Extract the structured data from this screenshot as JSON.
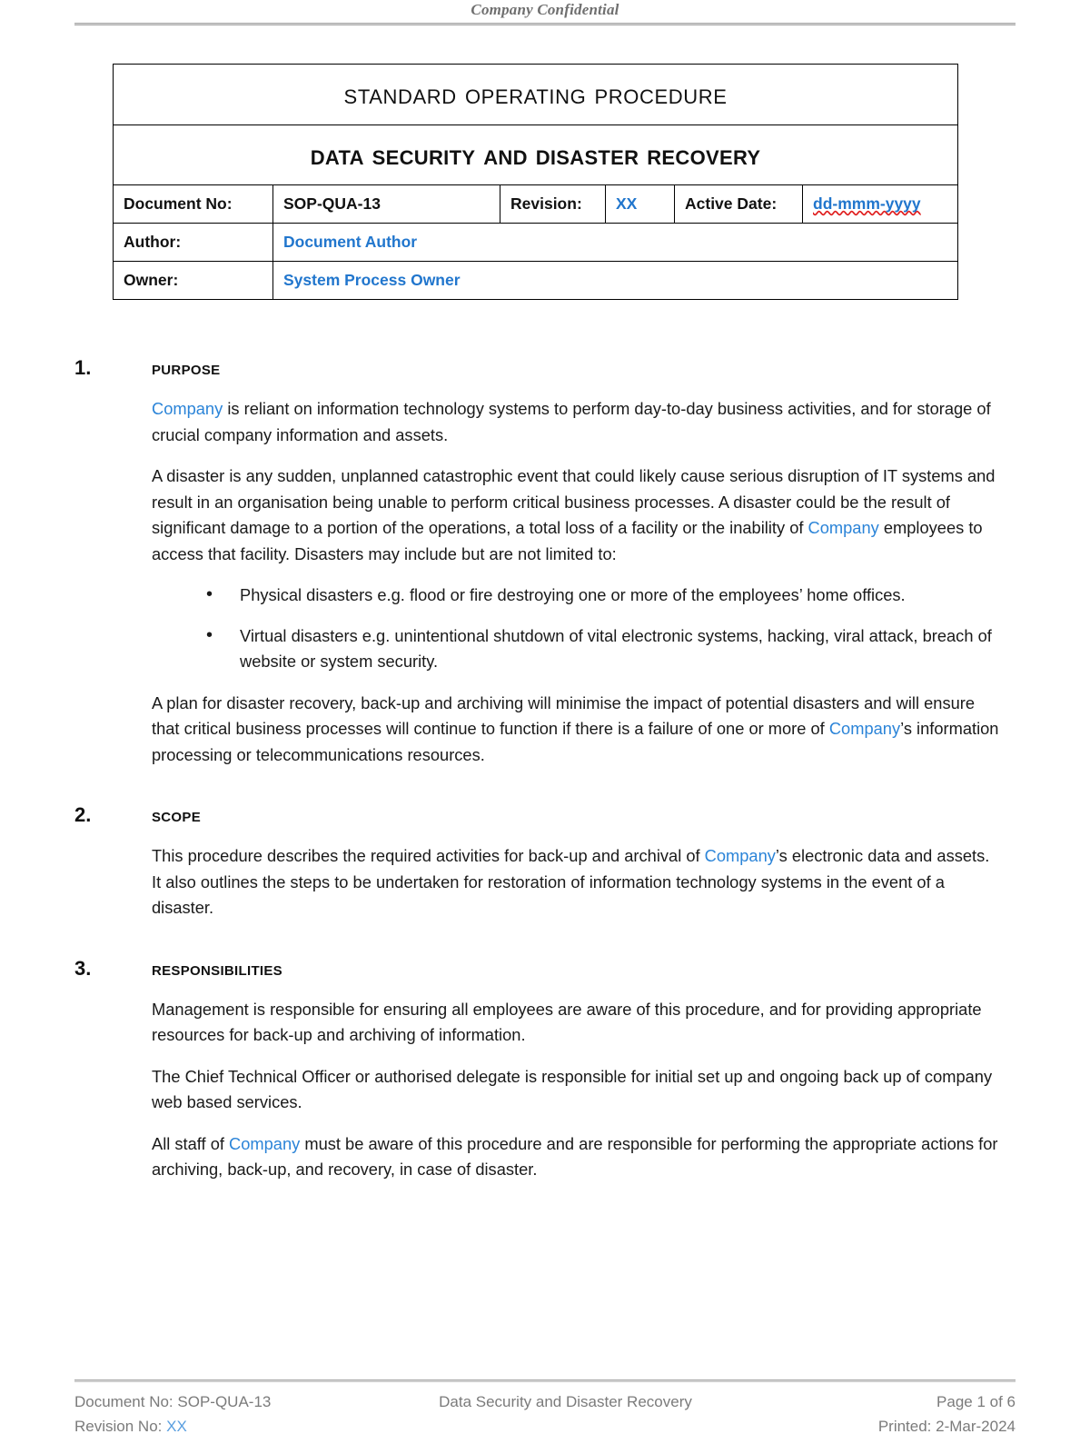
{
  "header": {
    "confidential_text": "Company Confidential"
  },
  "title_table": {
    "sop_label": "Standard Operating Procedure",
    "document_title": "Data Security and Disaster Recovery",
    "rows": {
      "document_no_label": "Document No:",
      "document_no_value": "SOP-QUA-13",
      "revision_label": "Revision:",
      "revision_value": "XX",
      "active_date_label": "Active Date:",
      "active_date_value": "dd-mmm-yyyy",
      "author_label": "Author:",
      "author_value": "Document Author",
      "owner_label": "Owner:",
      "owner_value": "System Process Owner"
    }
  },
  "sections": [
    {
      "number": "1.",
      "title": "Purpose",
      "paragraphs": [
        {
          "parts": [
            {
              "text": "Company",
              "style": "blue"
            },
            {
              "text": " is reliant on information technology systems to perform day-to-day business activities, and for storage of crucial company information and assets.",
              "style": "normal"
            }
          ]
        },
        {
          "parts": [
            {
              "text": "A disaster is any sudden, unplanned catastrophic event that could likely cause serious disruption of IT systems and result in an organisation being unable to perform critical business processes. A disaster could be the result of significant damage to a portion of the operations, a total loss of a facility or the inability of ",
              "style": "normal"
            },
            {
              "text": "Company",
              "style": "blue"
            },
            {
              "text": " employees to access that facility. Disasters may include but are not limited to:",
              "style": "normal"
            }
          ]
        }
      ],
      "bullets": [
        "Physical disasters e.g. flood or fire destroying one or more of the employees’ home offices.",
        "Virtual disasters e.g. unintentional shutdown of vital electronic systems, hacking, viral attack, breach of website or system security."
      ],
      "paragraphs_after": [
        {
          "parts": [
            {
              "text": "A plan for disaster recovery, back-up and archiving will minimise the impact of potential disasters and will ensure that critical business processes will continue to function if there is a failure of one or more of ",
              "style": "normal"
            },
            {
              "text": "Company",
              "style": "blue"
            },
            {
              "text": "’s information processing or telecommunications resources.",
              "style": "normal"
            }
          ]
        }
      ]
    },
    {
      "number": "2.",
      "title": "Scope",
      "paragraphs": [
        {
          "parts": [
            {
              "text": "This procedure describes the required activities for back-up and archival of ",
              "style": "normal"
            },
            {
              "text": "Company",
              "style": "blue"
            },
            {
              "text": "’s electronic data and assets. It also outlines the steps to be undertaken for restoration of information technology systems in the event of a disaster.",
              "style": "normal"
            }
          ]
        }
      ],
      "bullets": [],
      "paragraphs_after": []
    },
    {
      "number": "3.",
      "title": "Responsibilities",
      "paragraphs": [
        {
          "parts": [
            {
              "text": "Management is responsible for ensuring all employees are aware of this procedure, and for providing appropriate resources for back-up and archiving of information.",
              "style": "normal"
            }
          ]
        },
        {
          "parts": [
            {
              "text": "The Chief Technical Officer or authorised delegate is responsible for initial set up and ongoing back up of company web based services.",
              "style": "normal"
            }
          ]
        },
        {
          "parts": [
            {
              "text": "All staff of ",
              "style": "normal"
            },
            {
              "text": "Company",
              "style": "blue"
            },
            {
              "text": " must be aware of this procedure and are responsible for performing the appropriate actions for archiving, back-up, and recovery, in case of disaster.",
              "style": "normal"
            }
          ]
        }
      ],
      "bullets": [],
      "paragraphs_after": []
    }
  ],
  "footer": {
    "left_line1": "Document No: SOP-QUA-13",
    "left_line2_label": "Revision No: ",
    "left_line2_value": "XX",
    "center_line1": "Data Security and Disaster Recovery",
    "right_line1": "Page 1 of 6",
    "right_line2": "Printed:  2-Mar-2024"
  },
  "colors": {
    "placeholder_blue": "#2176cd",
    "body_blue": "#2b84d8",
    "footer_gray": "#7b7b7b",
    "spellcheck_red": "#e02020"
  }
}
